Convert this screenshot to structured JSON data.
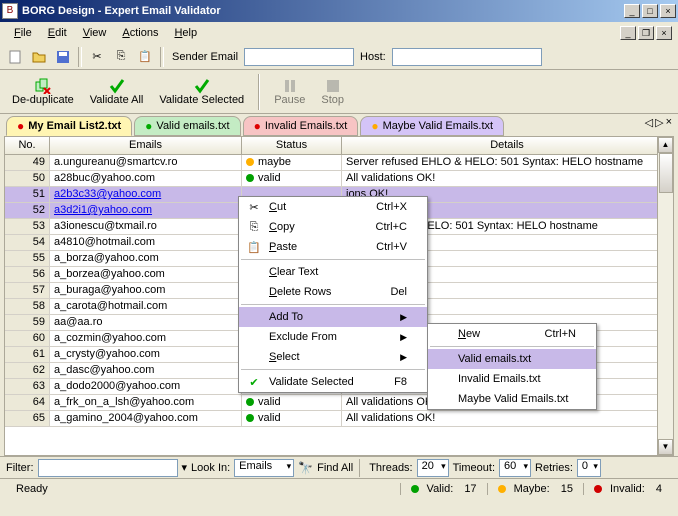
{
  "title": "BORG Design - Expert Email Validator",
  "menus": [
    "File",
    "Edit",
    "View",
    "Actions",
    "Help"
  ],
  "toolbar": {
    "sender_label": "Sender Email",
    "host_label": "Host:",
    "sender_value": "",
    "host_value": ""
  },
  "actions": {
    "dedup": "De-duplicate",
    "validate_all": "Validate All",
    "validate_sel": "Validate Selected",
    "pause": "Pause",
    "stop": "Stop"
  },
  "tabs": [
    {
      "label": "My Email List2.txt",
      "active": true
    },
    {
      "label": "Valid emails.txt",
      "active": false
    },
    {
      "label": "Invalid Emails.txt",
      "active": false
    },
    {
      "label": "Maybe Valid Emails.txt",
      "active": false
    }
  ],
  "columns": {
    "no": "No.",
    "emails": "Emails",
    "status": "Status",
    "details": "Details"
  },
  "rows": [
    {
      "no": "49",
      "email": "a.ungureanu@smartcv.ro",
      "link": false,
      "status": "maybe",
      "details": "Server refused EHLO & HELO: 501 Syntax: HELO hostname",
      "sel": false
    },
    {
      "no": "50",
      "email": "a28buc@yahoo.com",
      "link": false,
      "status": "valid",
      "details": "All validations OK!",
      "sel": false
    },
    {
      "no": "51",
      "email": "a2b3c33@yahoo.com",
      "link": true,
      "status": "",
      "details": "ions OK!",
      "sel": true
    },
    {
      "no": "52",
      "email": "a3d2i1@yahoo.com",
      "link": true,
      "status": "",
      "details": "ions OK!",
      "sel": true
    },
    {
      "no": "53",
      "email": "a3ionescu@txmail.ro",
      "link": false,
      "status": "",
      "details": "fused EHLO & HELO: 501 Syntax: HELO hostname",
      "sel": false
    },
    {
      "no": "54",
      "email": "a4810@hotmail.com",
      "link": false,
      "status": "",
      "details": "ions OK!",
      "sel": false
    },
    {
      "no": "55",
      "email": "a_borza@yahoo.com",
      "link": false,
      "status": "",
      "details": "ions OK!",
      "sel": false
    },
    {
      "no": "56",
      "email": "a_borzea@yahoo.com",
      "link": false,
      "status": "",
      "details": "ions OK!",
      "sel": false
    },
    {
      "no": "57",
      "email": "a_buraga@yahoo.com",
      "link": false,
      "status": "",
      "details": "ions OK!",
      "sel": false
    },
    {
      "no": "58",
      "email": "a_carota@hotmail.com",
      "link": false,
      "status": "",
      "details": "ions OK!",
      "sel": false
    },
    {
      "no": "59",
      "email": "aa@aa.ro",
      "link": false,
      "status": "",
      "details": "@aa.ro>...",
      "sel": false
    },
    {
      "no": "60",
      "email": "a_cozmin@yahoo.com",
      "link": false,
      "status": "",
      "details": "",
      "sel": false
    },
    {
      "no": "61",
      "email": "a_crysty@yahoo.com",
      "link": false,
      "status": "",
      "details": "",
      "sel": false
    },
    {
      "no": "62",
      "email": "a_dasc@yahoo.com",
      "link": false,
      "status": "",
      "details": "",
      "sel": false
    },
    {
      "no": "63",
      "email": "a_dodo2000@yahoo.com",
      "link": false,
      "status": "valid",
      "details": "All validations OK!",
      "sel": false
    },
    {
      "no": "64",
      "email": "a_frk_on_a_lsh@yahoo.com",
      "link": false,
      "status": "valid",
      "details": "All validations OK!",
      "sel": false
    },
    {
      "no": "65",
      "email": "a_gamino_2004@yahoo.com",
      "link": false,
      "status": "valid",
      "details": "All validations OK!",
      "sel": false
    }
  ],
  "context1": {
    "cut": "Cut",
    "cut_sc": "Ctrl+X",
    "copy": "Copy",
    "copy_sc": "Ctrl+C",
    "paste": "Paste",
    "paste_sc": "Ctrl+V",
    "clear": "Clear Text",
    "delete": "Delete Rows",
    "delete_sc": "Del",
    "addto": "Add To",
    "exclude": "Exclude From",
    "select": "Select",
    "validate": "Validate Selected",
    "validate_sc": "F8"
  },
  "context2": {
    "new": "New",
    "new_sc": "Ctrl+N",
    "valid": "Valid emails.txt",
    "invalid": "Invalid Emails.txt",
    "maybe": "Maybe Valid Emails.txt"
  },
  "filter": {
    "label": "Filter:",
    "value": "",
    "lookin_label": "Look In:",
    "lookin_value": "Emails",
    "findall": "Find All",
    "threads_label": "Threads:",
    "threads_value": "20",
    "timeout_label": "Timeout:",
    "timeout_value": "60",
    "retries_label": "Retries:",
    "retries_value": "0"
  },
  "status": {
    "ready": "Ready",
    "valid_label": "Valid:",
    "valid_value": "17",
    "maybe_label": "Maybe:",
    "maybe_value": "15",
    "invalid_label": "Invalid:",
    "invalid_value": "4"
  }
}
